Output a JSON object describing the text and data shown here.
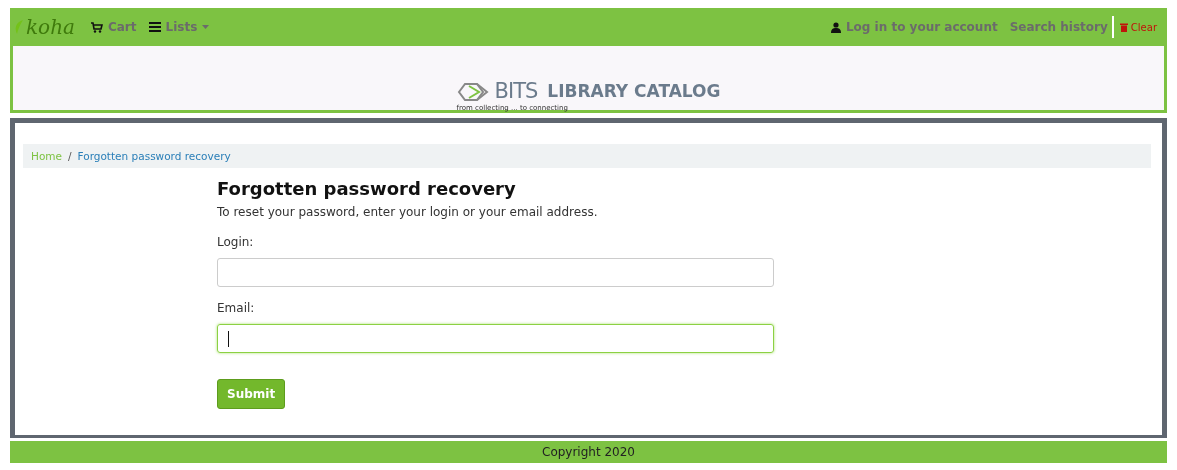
{
  "navbar": {
    "logo": "koha",
    "cart": "Cart",
    "lists": "Lists",
    "login": "Log in to your account",
    "search_history": "Search history",
    "clear": "Clear"
  },
  "header": {
    "brand": "BITS",
    "tagline": "from collecting ... to connecting",
    "title": "LIBRARY CATALOG"
  },
  "breadcrumb_separator": "/",
  "breadcrumbs": [
    {
      "label": "Home",
      "current": false
    },
    {
      "label": "Forgotten password recovery",
      "current": true
    }
  ],
  "form": {
    "heading": "Forgotten password recovery",
    "intro": "To reset your password, enter your login or your email address.",
    "fields": [
      {
        "label": "Login:",
        "focused": false
      },
      {
        "label": "Email:",
        "focused": true
      }
    ],
    "submit": "Submit"
  },
  "footer": "Copyright 2020"
}
